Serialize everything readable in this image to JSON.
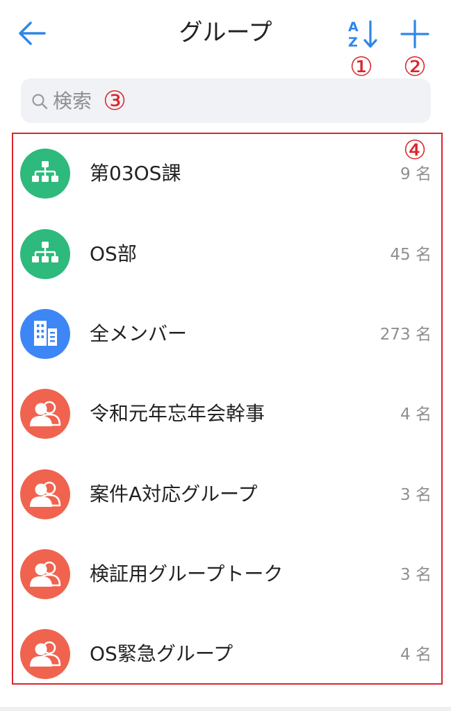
{
  "header": {
    "title": "グループ",
    "back_icon": "arrow-left-icon",
    "sort_icon": "sort-az-icon",
    "add_icon": "plus-icon"
  },
  "callouts": {
    "sort": "①",
    "add": "②",
    "search": "③",
    "list": "④"
  },
  "search": {
    "placeholder": "検索",
    "value": ""
  },
  "groups": [
    {
      "name": "第03OS課",
      "count": "9 名",
      "icon": "org-chart-icon",
      "color": "#2dba7c"
    },
    {
      "name": "OS部",
      "count": "45 名",
      "icon": "org-chart-icon",
      "color": "#2dba7c"
    },
    {
      "name": "全メンバー",
      "count": "273 名",
      "icon": "building-icon",
      "color": "#3d86f5"
    },
    {
      "name": "令和元年忘年会幹事",
      "count": "4 名",
      "icon": "people-icon",
      "color": "#f0634f"
    },
    {
      "name": "案件A対応グループ",
      "count": "3 名",
      "icon": "people-icon",
      "color": "#f0634f"
    },
    {
      "name": "検証用グループトーク",
      "count": "3 名",
      "icon": "people-icon",
      "color": "#f0634f"
    },
    {
      "name": "OS緊急グループ",
      "count": "4 名",
      "icon": "people-icon",
      "color": "#f0634f"
    }
  ],
  "colors": {
    "accent": "#2f86e6",
    "annotation": "#d9262c"
  }
}
